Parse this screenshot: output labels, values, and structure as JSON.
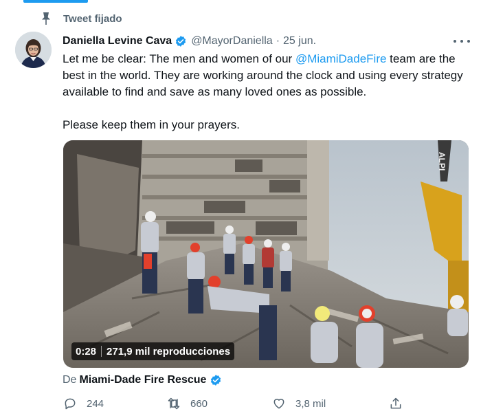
{
  "pinned": {
    "label": "Tweet fijado"
  },
  "author": {
    "display_name": "Daniella Levine Cava",
    "handle": "@MayorDaniella",
    "separator": "·",
    "date": "25 jun."
  },
  "tweet": {
    "text_before_mention": "Let me be clear: The men and women of our ",
    "mention": "@MiamiDadeFire",
    "text_after_mention": " team are the best in the world. They are working around the clock and using every strategy available to find and save as many loved ones as possible.",
    "paragraph2": "Please keep them in your prayers."
  },
  "media": {
    "duration": "0:28",
    "views": "271,9 mil reproducciones",
    "overlay_text": "ALPI"
  },
  "from": {
    "prefix": "De",
    "source": "Miami-Dade Fire Rescue"
  },
  "actions": {
    "reply_count": "244",
    "retweet_count": "660",
    "like_count": "3,8 mil"
  },
  "colors": {
    "accent": "#1d9bf0",
    "muted": "#536471",
    "text": "#0f1419"
  },
  "icons": [
    "pin-icon",
    "verified-badge-icon",
    "more-icon",
    "reply-icon",
    "retweet-icon",
    "like-icon",
    "share-icon"
  ]
}
